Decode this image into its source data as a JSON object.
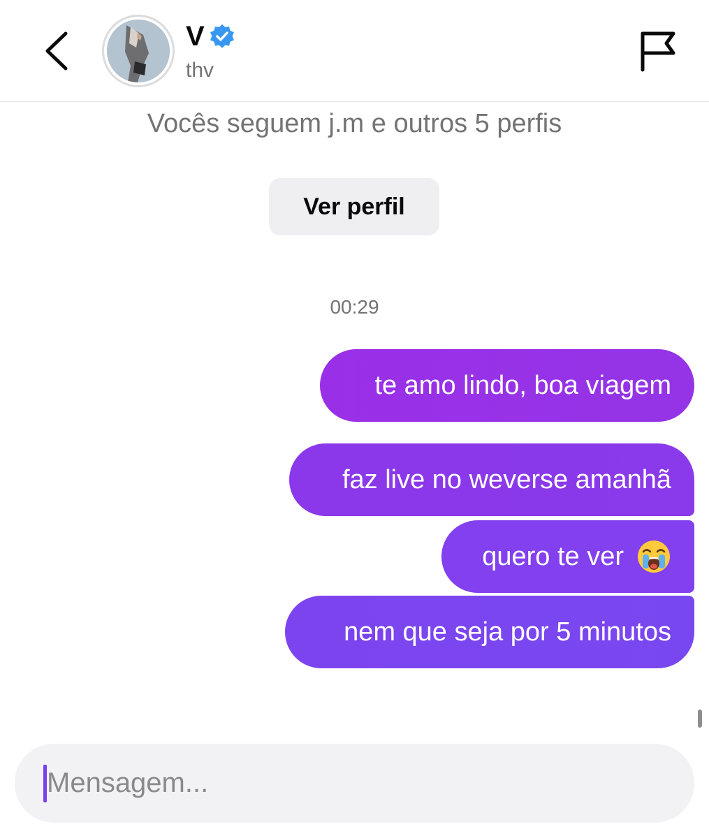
{
  "header": {
    "name": "V",
    "handle": "thv",
    "icons": {
      "back": "chevron-left-icon",
      "verified": "verified-badge-icon",
      "report": "flag-icon"
    },
    "verified_color": "#3897f0"
  },
  "profile_info": {
    "mutuals_text": "Vocês seguem j.m e outros 5 perfis",
    "view_profile_label": "Ver perfil"
  },
  "conversation": {
    "timestamp": "00:29",
    "messages": [
      {
        "text": "te amo lindo, boa viagem",
        "sender": "me"
      },
      {
        "text": "faz live no weverse amanhã",
        "sender": "me"
      },
      {
        "text": "quero te ver",
        "sender": "me",
        "emoji": "loudly-crying-face-icon"
      },
      {
        "text": "nem que seja por 5 minutos",
        "sender": "me"
      }
    ]
  },
  "composer": {
    "placeholder": "Mensagem...",
    "value": ""
  },
  "colors": {
    "bubble_top": "#9a2fe8",
    "bubble_bottom": "#7947f0",
    "secondary_text": "#737373",
    "button_bg": "#efeff2",
    "composer_bg": "#f2f2f5"
  }
}
